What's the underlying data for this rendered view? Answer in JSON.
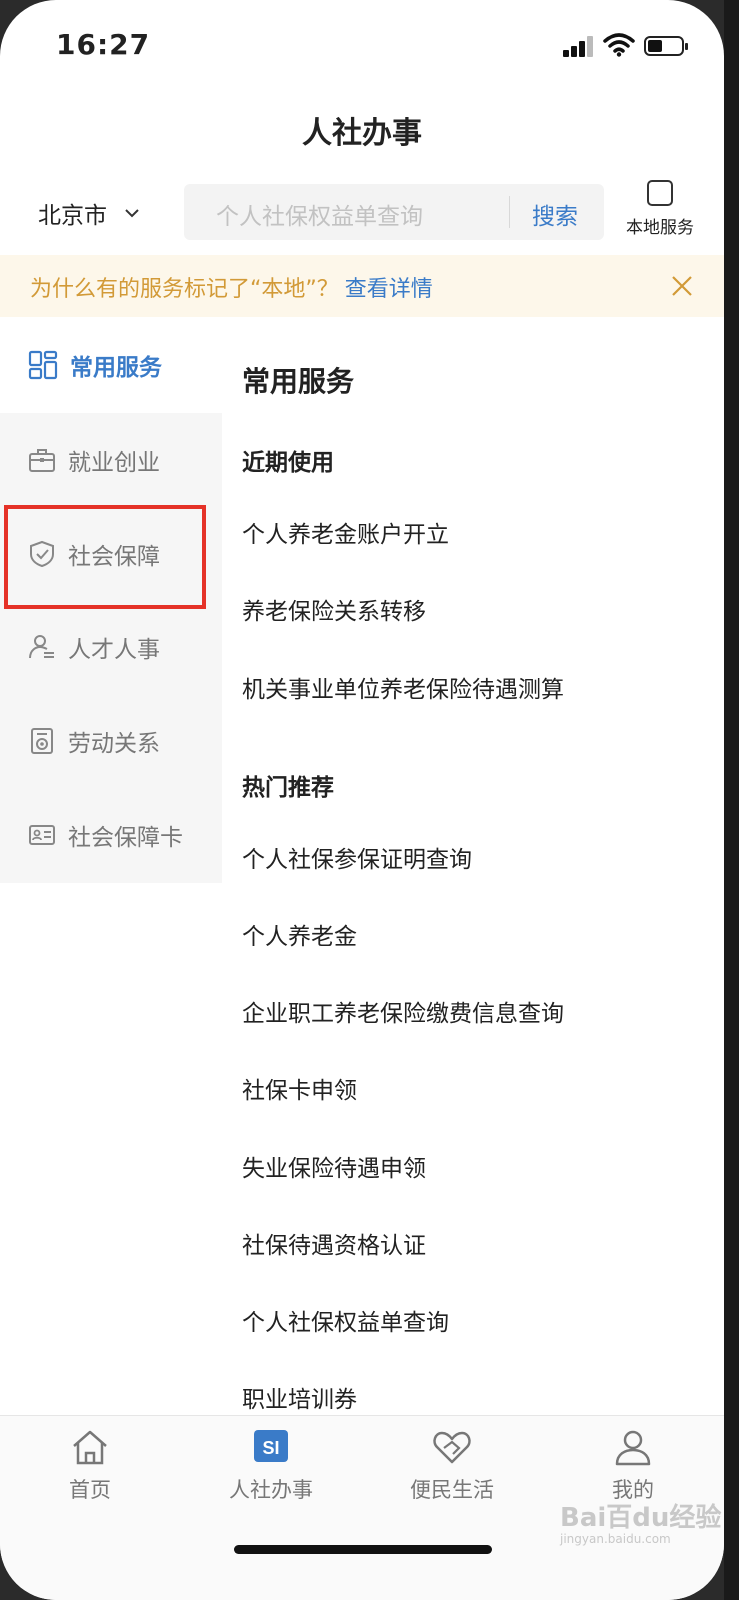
{
  "status": {
    "time": "16:27"
  },
  "header": {
    "title": "人社办事"
  },
  "search": {
    "city": "北京市",
    "placeholder": "个人社保权益单查询",
    "button": "搜索",
    "local_label": "本地服务"
  },
  "notice": {
    "text": "为什么有的服务标记了“本地”？",
    "link": "查看详情"
  },
  "sidebar": {
    "items": [
      {
        "label": "常用服务",
        "icon": "grid-icon",
        "active": true
      },
      {
        "label": "就业创业",
        "icon": "briefcase-icon"
      },
      {
        "label": "社会保障",
        "icon": "shield-check-icon"
      },
      {
        "label": "人才人事",
        "icon": "user-list-icon"
      },
      {
        "label": "劳动关系",
        "icon": "document-icon"
      },
      {
        "label": "社会保障卡",
        "icon": "id-card-icon"
      }
    ]
  },
  "main": {
    "title": "常用服务",
    "recent": {
      "title": "近期使用",
      "items": [
        "个人养老金账户开立",
        "养老保险关系转移",
        "机关事业单位养老保险待遇测算"
      ]
    },
    "hot": {
      "title": "热门推荐",
      "items": [
        "个人社保参保证明查询",
        "个人养老金",
        "企业职工养老保险缴费信息查询",
        "社保卡申领",
        "失业保险待遇申领",
        "社保待遇资格认证",
        "个人社保权益单查询",
        "职业培训券"
      ]
    }
  },
  "tabbar": {
    "items": [
      {
        "label": "首页",
        "icon": "home-icon"
      },
      {
        "label": "人社办事",
        "icon": "si-icon",
        "active": true,
        "badge": "SI"
      },
      {
        "label": "便民生活",
        "icon": "heart-hand-icon"
      },
      {
        "label": "我的",
        "icon": "person-icon"
      }
    ]
  },
  "watermark": {
    "text": "Bai百du经验",
    "sub": "jingyan.baidu.com"
  },
  "colors": {
    "accent": "#3a7bc8",
    "notice_text": "#d29a37",
    "notice_bg": "#fdf7ea",
    "highlight": "#e53228"
  }
}
